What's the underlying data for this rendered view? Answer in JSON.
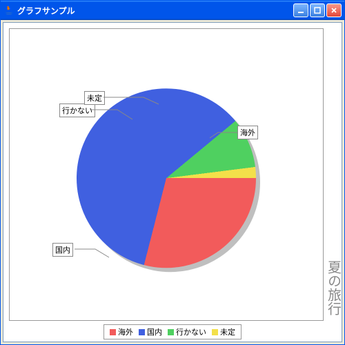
{
  "window": {
    "title": "グラフサンプル",
    "buttons": {
      "min": "–",
      "max": "□",
      "close": "×"
    }
  },
  "sideTitle": "夏の旅行",
  "legend": [
    {
      "label": "海外",
      "color": "#f25b5b"
    },
    {
      "label": "国内",
      "color": "#4060e0"
    },
    {
      "label": "行かない",
      "color": "#4fd060"
    },
    {
      "label": "未定",
      "color": "#f3e04a"
    }
  ],
  "chart_data": {
    "type": "pie",
    "title": "夏の旅行",
    "series": [
      {
        "name": "海外",
        "value": 29,
        "color": "#f25b5b"
      },
      {
        "name": "国内",
        "value": 60,
        "color": "#4060e0"
      },
      {
        "name": "行かない",
        "value": 9,
        "color": "#4fd060"
      },
      {
        "name": "未定",
        "value": 2,
        "color": "#f3e04a"
      }
    ],
    "startAngleDeg": 0,
    "legendPosition": "bottom"
  }
}
